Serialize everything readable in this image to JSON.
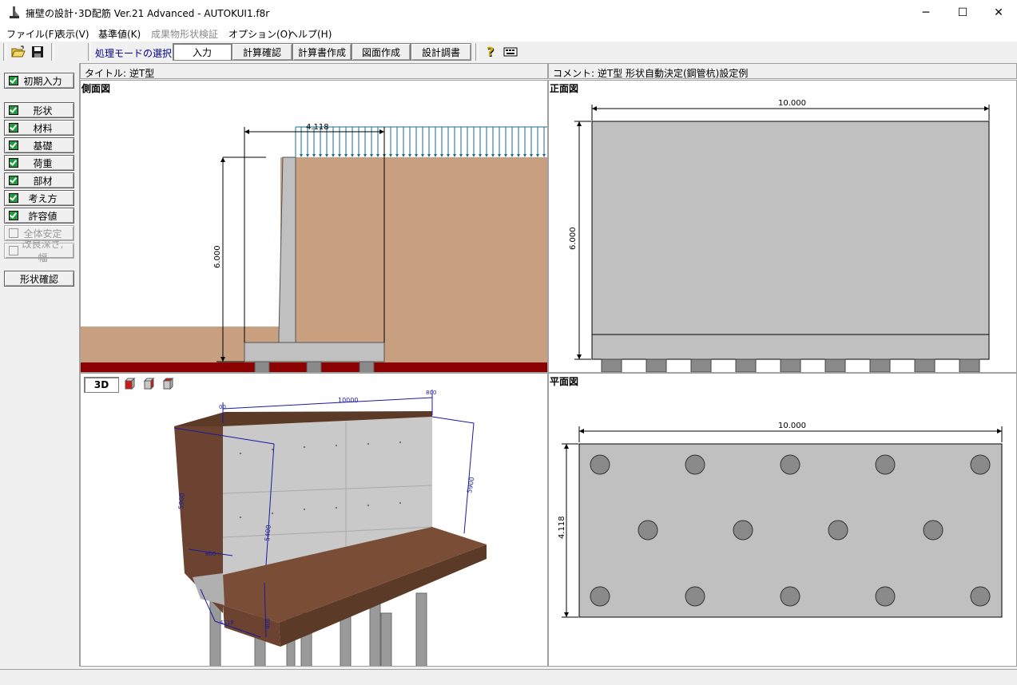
{
  "window": {
    "title": "擁壁の設計･3D配筋 Ver.21 Advanced  - AUTOKUI1.f8r",
    "minimize": "─",
    "maximize": "☐",
    "close": "✕"
  },
  "menu": [
    {
      "label": "ファイル(F)",
      "enabled": true
    },
    {
      "label": "表示(V)",
      "enabled": true
    },
    {
      "label": "基準値(K)",
      "enabled": true
    },
    {
      "label": "成果物形状検証",
      "enabled": false
    },
    {
      "label": "オプション(O)",
      "enabled": true
    },
    {
      "label": "ヘルプ(H)",
      "enabled": true
    }
  ],
  "toolbar": {
    "open_icon": "folder-open-icon",
    "save_icon": "floppy-save-icon",
    "mode_label": "処理モードの選択",
    "modes": [
      "入力",
      "計算確認",
      "計算書作成",
      "図面作成",
      "設計調書"
    ],
    "active_mode": "入力",
    "help_icon": "help-question-icon",
    "extra_icon": "keyboard-icon"
  },
  "sidebar": {
    "items": [
      {
        "label": "初期入力",
        "checked": true,
        "enabled": true
      },
      {
        "label": "形状",
        "checked": true,
        "enabled": true
      },
      {
        "label": "材料",
        "checked": true,
        "enabled": true
      },
      {
        "label": "基礎",
        "checked": true,
        "enabled": true
      },
      {
        "label": "荷重",
        "checked": true,
        "enabled": true
      },
      {
        "label": "部材",
        "checked": true,
        "enabled": true
      },
      {
        "label": "考え方",
        "checked": true,
        "enabled": true
      },
      {
        "label": "許容値",
        "checked": true,
        "enabled": true
      },
      {
        "label": "全体安定",
        "checked": false,
        "enabled": false
      },
      {
        "label": "改良深さ,幅",
        "checked": false,
        "enabled": false
      }
    ],
    "shape_confirm": "形状確認"
  },
  "info": {
    "title_text": "タイトル:  逆T型",
    "comment_text": "コメント:  逆T型 形状自動決定(鋼管杭)設定例"
  },
  "side_view": {
    "label": "側面図",
    "dim_width": "4.118",
    "dim_height": "6.000"
  },
  "front_view": {
    "label": "正面図",
    "dim_width": "10.000",
    "dim_height": "6.000"
  },
  "plan_view": {
    "label": "平面図",
    "dim_width": "10.000",
    "dim_height": "4.118",
    "piles": {
      "rows": 3,
      "outer_row_count": 5,
      "middle_row_count": 4
    }
  },
  "view3d": {
    "button": "3D",
    "view_icons": [
      "cube-front-icon",
      "cube-side-icon",
      "cube-top-icon"
    ],
    "dim_top": "10000",
    "dim_top_small_left": "00",
    "dim_top_small_right": "800",
    "dim_side": "5900",
    "dim_wall": "5400",
    "dim_left": "5900",
    "dim_footing": "800",
    "dim_bottom": "4118",
    "dim_base": "800"
  },
  "colors": {
    "soil": "#c9a07f",
    "concrete": "#c0c0c0",
    "base_layer": "#8b0000",
    "load_arrow": "#1a6b8f",
    "check_green": "#1e9b3a"
  }
}
